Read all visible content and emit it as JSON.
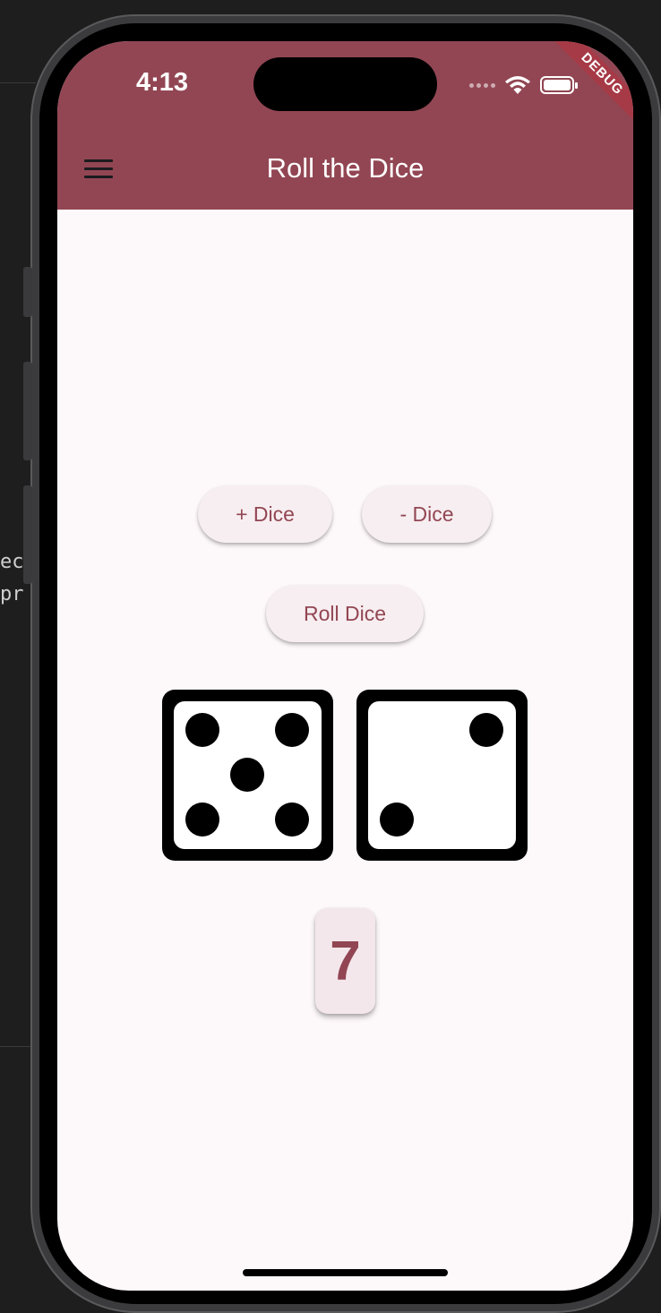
{
  "status_bar": {
    "time": "4:13"
  },
  "debug_banner": "DEBUG",
  "app_bar": {
    "title": "Roll the Dice",
    "menu_icon": "hamburger-menu-icon"
  },
  "buttons": {
    "add_dice": "+ Dice",
    "remove_dice": "- Dice",
    "roll_dice": "Roll Dice"
  },
  "dice": [
    {
      "value": 5
    },
    {
      "value": 2
    }
  ],
  "total": "7",
  "background_code": [
    "ec",
    "pr"
  ],
  "colors": {
    "app_bar": "#924653",
    "button_bg": "#f7eef1",
    "button_text": "#924653",
    "screen_bg": "#fdf8fa"
  }
}
